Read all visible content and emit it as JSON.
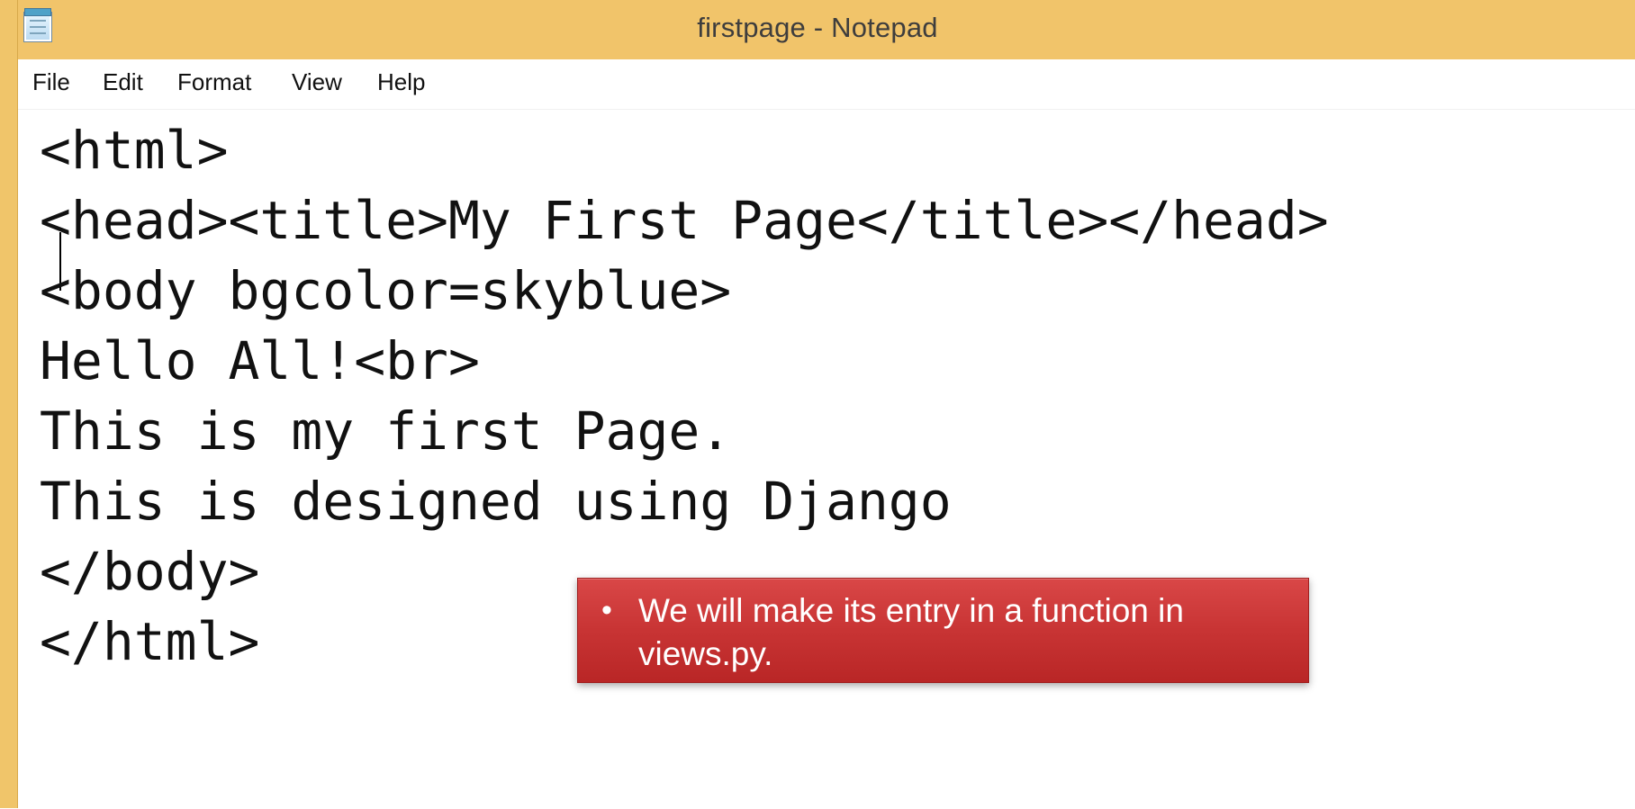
{
  "window": {
    "title": "firstpage - Notepad",
    "app": "Notepad",
    "icon": "notepad-icon",
    "colors": {
      "titlebar": "#f1c46a",
      "editor_background": "#ffffff",
      "callout_background": "#c83434",
      "callout_text": "#ffffff"
    }
  },
  "menu": {
    "items": [
      {
        "label": "File"
      },
      {
        "label": "Edit"
      },
      {
        "label": "Format"
      },
      {
        "label": "View"
      },
      {
        "label": "Help"
      }
    ]
  },
  "editor": {
    "lines": [
      "<html>",
      "<head><title>My First Page</title></head>",
      "<body bgcolor=skyblue>",
      "Hello All!<br>",
      "This is my first Page.",
      "This is designed using Django",
      "</body>",
      "</html>"
    ]
  },
  "callout": {
    "bullet": "•",
    "text": "We will make its entry in a function in views.py."
  }
}
